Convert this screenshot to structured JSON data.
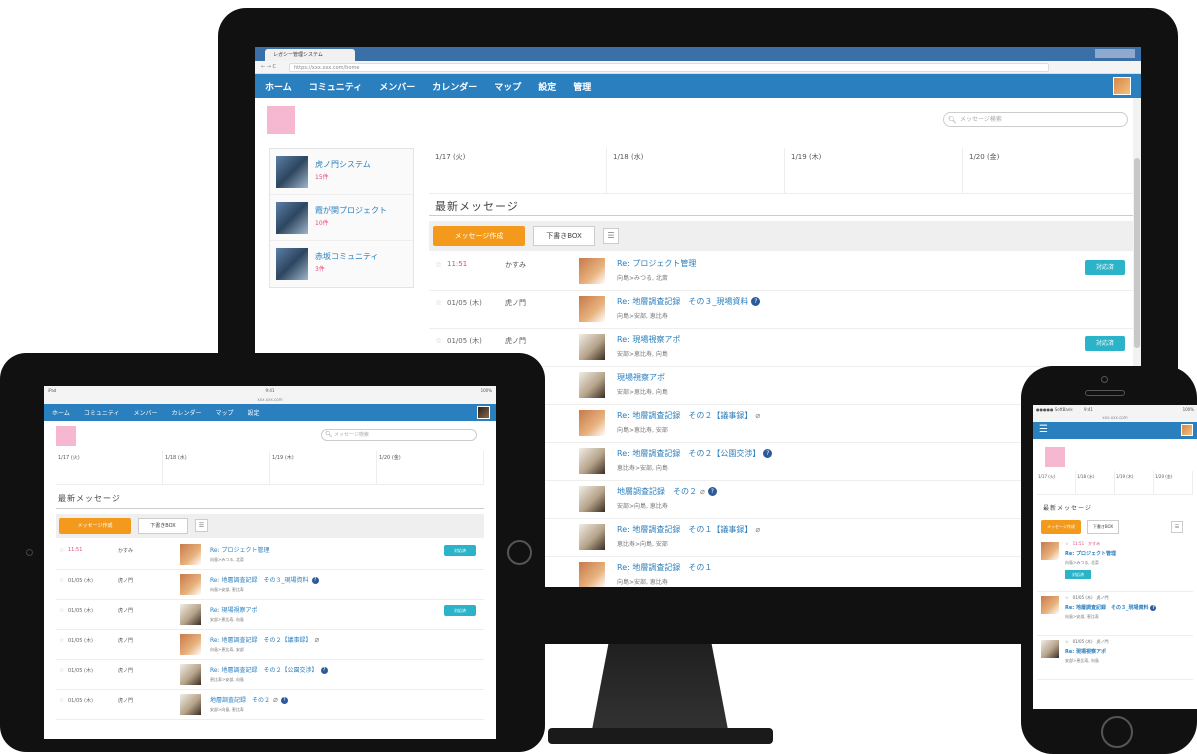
{
  "browser": {
    "tab_title": "レガシー管理システム",
    "url": "https://xxx.xxx.com/home"
  },
  "desktop": {
    "nav": [
      "ホーム",
      "コミュニティ",
      "メンバー",
      "カレンダー",
      "マップ",
      "設定",
      "管理"
    ],
    "search_placeholder": "メッセージ検索",
    "communities": [
      {
        "name": "虎ノ門システム",
        "count": "15件"
      },
      {
        "name": "霞が関プロジェクト",
        "count": "10件"
      },
      {
        "name": "赤坂コミュニティ",
        "count": "3件"
      }
    ],
    "calendar_days": [
      "1/17 (火)",
      "1/18 (水)",
      "1/19 (木)",
      "1/20 (金)"
    ],
    "section_title": "最新メッセージ",
    "compose_label": "メッセージ作成",
    "draft_label": "下書きBOX",
    "list_icon": "☰",
    "messages": [
      {
        "star": "☆",
        "date": "11:51",
        "unread": true,
        "sender": "かすみ",
        "subject": "Re: プロジェクト管理",
        "recips": "向島>みつる, 北斎",
        "badge": "対応済",
        "info": false,
        "clip": false,
        "dark": false
      },
      {
        "star": "☆",
        "date": "01/05 (木)",
        "unread": false,
        "sender": "虎ノ門",
        "subject": "Re: 地層調査記録　その３_現場資料",
        "recips": "向島>安部, 恵比寿",
        "badge": "",
        "info": true,
        "clip": false,
        "dark": false
      },
      {
        "star": "☆",
        "date": "01/05 (木)",
        "unread": false,
        "sender": "虎ノ門",
        "subject": "Re: 現場視察アポ",
        "recips": "安部>恵比寿, 向島",
        "badge": "対応済",
        "info": false,
        "clip": false,
        "dark": true
      },
      {
        "star": "",
        "date": "",
        "unread": false,
        "sender": "",
        "subject": "現場視察アポ",
        "recips": "安部>恵比寿, 向島",
        "badge": "",
        "info": false,
        "clip": false,
        "dark": true
      },
      {
        "star": "",
        "date": "",
        "unread": false,
        "sender": "",
        "subject": "Re: 地層調査記録　その２【議事録】",
        "recips": "向島>恵比寿, 安部",
        "badge": "",
        "info": false,
        "clip": true,
        "dark": false
      },
      {
        "star": "",
        "date": "",
        "unread": false,
        "sender": "",
        "subject": "Re: 地層調査記録　その２【公園交渉】",
        "recips": "恵比寿>安部, 向島",
        "badge": "",
        "info": true,
        "clip": false,
        "dark": true
      },
      {
        "star": "",
        "date": "",
        "unread": false,
        "sender": "",
        "subject": "地層調査記録　その２",
        "recips": "安部>向島, 恵比寿",
        "badge": "",
        "info": true,
        "clip": true,
        "dark": true
      },
      {
        "star": "",
        "date": "",
        "unread": false,
        "sender": "",
        "subject": "Re: 地層調査記録　その１【議事録】",
        "recips": "恵比寿>向島, 安部",
        "badge": "",
        "info": false,
        "clip": true,
        "dark": true
      },
      {
        "star": "",
        "date": "",
        "unread": false,
        "sender": "",
        "subject": "Re: 地層調査記録　その１",
        "recips": "向島>安部, 恵比寿",
        "badge": "",
        "info": false,
        "clip": false,
        "dark": false
      }
    ]
  },
  "tablet": {
    "status_left": "iPad",
    "status_center": "9:41",
    "status_right": "100%",
    "url": "xxx.xxx.com",
    "nav": [
      "ホーム",
      "コミュニティ",
      "メンバー",
      "カレンダー",
      "マップ",
      "設定"
    ],
    "search_placeholder": "メッセージ検索",
    "calendar_days": [
      "1/17 (火)",
      "1/18 (水)",
      "1/19 (木)",
      "1/20 (金)"
    ],
    "section_title": "最新メッセージ",
    "compose_label": "メッセージ作成",
    "draft_label": "下書きBOX",
    "list_icon": "☰",
    "messages": [
      {
        "star": "☆",
        "date": "11:51",
        "unread": true,
        "sender": "かすみ",
        "subject": "Re: プロジェクト管理",
        "recips": "向島>みつる, 北斎",
        "badge": "対応済",
        "info": false,
        "clip": false,
        "dark": false
      },
      {
        "star": "☆",
        "date": "01/05 (木)",
        "unread": false,
        "sender": "虎ノ門",
        "subject": "Re: 地層調査記録　その３_現場資料",
        "recips": "向島>安部, 恵比寿",
        "badge": "",
        "info": true,
        "clip": false,
        "dark": false
      },
      {
        "star": "☆",
        "date": "01/05 (木)",
        "unread": false,
        "sender": "虎ノ門",
        "subject": "Re: 現場視察アポ",
        "recips": "安部>恵比寿, 向島",
        "badge": "対応済",
        "info": false,
        "clip": false,
        "dark": true
      },
      {
        "star": "☆",
        "date": "01/05 (木)",
        "unread": false,
        "sender": "虎ノ門",
        "subject": "Re: 地層調査記録　その２【議事録】",
        "recips": "向島>恵比寿, 安部",
        "badge": "",
        "info": false,
        "clip": true,
        "dark": false
      },
      {
        "star": "☆",
        "date": "01/05 (木)",
        "unread": false,
        "sender": "虎ノ門",
        "subject": "Re: 地層調査記録　その２【公園交渉】",
        "recips": "恵比寿>安部, 向島",
        "badge": "",
        "info": true,
        "clip": false,
        "dark": true
      },
      {
        "star": "☆",
        "date": "01/05 (木)",
        "unread": false,
        "sender": "虎ノ門",
        "subject": "地層調査記録　その２",
        "recips": "安部>向島, 恵比寿",
        "badge": "",
        "info": true,
        "clip": true,
        "dark": true
      }
    ]
  },
  "phone": {
    "status_left": "●●●●● SoftBank",
    "status_center": "9:41",
    "status_right": "100%",
    "url": "xxx.xxx.com",
    "hamburger": "☰",
    "calendar_days": [
      "1/17 (火)",
      "1/18 (水)",
      "1/19 (木)",
      "1/20 (金)"
    ],
    "section_title": "最新メッセージ",
    "compose_label": "メッセージ作成",
    "draft_label": "下書きBOX",
    "list_icon": "☰",
    "messages": [
      {
        "meta": "☆　11:51　かすみ",
        "unread": true,
        "subject": "Re: プロジェクト管理",
        "recips": "向島>みつる, 北斎",
        "badge": "対応済",
        "info": false,
        "dark": false
      },
      {
        "meta": "☆　01/05 (木)　虎ノ門",
        "unread": false,
        "subject": "Re: 地層調査記録　その３_現場資料",
        "recips": "向島>安部, 恵比寿",
        "badge": "",
        "info": true,
        "dark": false
      },
      {
        "meta": "☆　01/05 (木)　虎ノ門",
        "unread": false,
        "subject": "Re: 現場視察アポ",
        "recips": "安部>恵比寿, 向島",
        "badge": "",
        "info": false,
        "dark": true
      }
    ]
  }
}
